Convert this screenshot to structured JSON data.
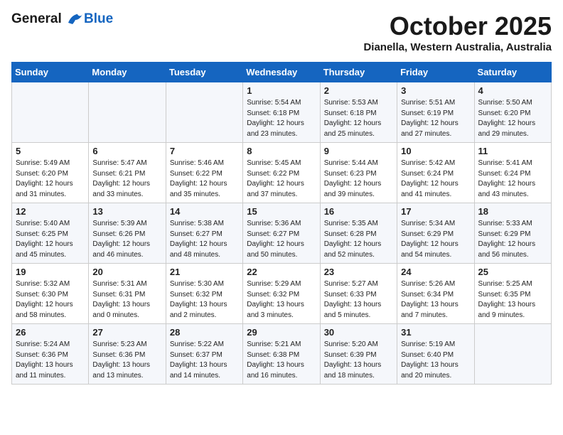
{
  "logo": {
    "line1": "General",
    "line2": "Blue"
  },
  "title": "October 2025",
  "location": "Dianella, Western Australia, Australia",
  "days_of_week": [
    "Sunday",
    "Monday",
    "Tuesday",
    "Wednesday",
    "Thursday",
    "Friday",
    "Saturday"
  ],
  "weeks": [
    [
      {
        "day": "",
        "info": ""
      },
      {
        "day": "",
        "info": ""
      },
      {
        "day": "",
        "info": ""
      },
      {
        "day": "1",
        "info": "Sunrise: 5:54 AM\nSunset: 6:18 PM\nDaylight: 12 hours\nand 23 minutes."
      },
      {
        "day": "2",
        "info": "Sunrise: 5:53 AM\nSunset: 6:18 PM\nDaylight: 12 hours\nand 25 minutes."
      },
      {
        "day": "3",
        "info": "Sunrise: 5:51 AM\nSunset: 6:19 PM\nDaylight: 12 hours\nand 27 minutes."
      },
      {
        "day": "4",
        "info": "Sunrise: 5:50 AM\nSunset: 6:20 PM\nDaylight: 12 hours\nand 29 minutes."
      }
    ],
    [
      {
        "day": "5",
        "info": "Sunrise: 5:49 AM\nSunset: 6:20 PM\nDaylight: 12 hours\nand 31 minutes."
      },
      {
        "day": "6",
        "info": "Sunrise: 5:47 AM\nSunset: 6:21 PM\nDaylight: 12 hours\nand 33 minutes."
      },
      {
        "day": "7",
        "info": "Sunrise: 5:46 AM\nSunset: 6:22 PM\nDaylight: 12 hours\nand 35 minutes."
      },
      {
        "day": "8",
        "info": "Sunrise: 5:45 AM\nSunset: 6:22 PM\nDaylight: 12 hours\nand 37 minutes."
      },
      {
        "day": "9",
        "info": "Sunrise: 5:44 AM\nSunset: 6:23 PM\nDaylight: 12 hours\nand 39 minutes."
      },
      {
        "day": "10",
        "info": "Sunrise: 5:42 AM\nSunset: 6:24 PM\nDaylight: 12 hours\nand 41 minutes."
      },
      {
        "day": "11",
        "info": "Sunrise: 5:41 AM\nSunset: 6:24 PM\nDaylight: 12 hours\nand 43 minutes."
      }
    ],
    [
      {
        "day": "12",
        "info": "Sunrise: 5:40 AM\nSunset: 6:25 PM\nDaylight: 12 hours\nand 45 minutes."
      },
      {
        "day": "13",
        "info": "Sunrise: 5:39 AM\nSunset: 6:26 PM\nDaylight: 12 hours\nand 46 minutes."
      },
      {
        "day": "14",
        "info": "Sunrise: 5:38 AM\nSunset: 6:27 PM\nDaylight: 12 hours\nand 48 minutes."
      },
      {
        "day": "15",
        "info": "Sunrise: 5:36 AM\nSunset: 6:27 PM\nDaylight: 12 hours\nand 50 minutes."
      },
      {
        "day": "16",
        "info": "Sunrise: 5:35 AM\nSunset: 6:28 PM\nDaylight: 12 hours\nand 52 minutes."
      },
      {
        "day": "17",
        "info": "Sunrise: 5:34 AM\nSunset: 6:29 PM\nDaylight: 12 hours\nand 54 minutes."
      },
      {
        "day": "18",
        "info": "Sunrise: 5:33 AM\nSunset: 6:29 PM\nDaylight: 12 hours\nand 56 minutes."
      }
    ],
    [
      {
        "day": "19",
        "info": "Sunrise: 5:32 AM\nSunset: 6:30 PM\nDaylight: 12 hours\nand 58 minutes."
      },
      {
        "day": "20",
        "info": "Sunrise: 5:31 AM\nSunset: 6:31 PM\nDaylight: 13 hours\nand 0 minutes."
      },
      {
        "day": "21",
        "info": "Sunrise: 5:30 AM\nSunset: 6:32 PM\nDaylight: 13 hours\nand 2 minutes."
      },
      {
        "day": "22",
        "info": "Sunrise: 5:29 AM\nSunset: 6:32 PM\nDaylight: 13 hours\nand 3 minutes."
      },
      {
        "day": "23",
        "info": "Sunrise: 5:27 AM\nSunset: 6:33 PM\nDaylight: 13 hours\nand 5 minutes."
      },
      {
        "day": "24",
        "info": "Sunrise: 5:26 AM\nSunset: 6:34 PM\nDaylight: 13 hours\nand 7 minutes."
      },
      {
        "day": "25",
        "info": "Sunrise: 5:25 AM\nSunset: 6:35 PM\nDaylight: 13 hours\nand 9 minutes."
      }
    ],
    [
      {
        "day": "26",
        "info": "Sunrise: 5:24 AM\nSunset: 6:36 PM\nDaylight: 13 hours\nand 11 minutes."
      },
      {
        "day": "27",
        "info": "Sunrise: 5:23 AM\nSunset: 6:36 PM\nDaylight: 13 hours\nand 13 minutes."
      },
      {
        "day": "28",
        "info": "Sunrise: 5:22 AM\nSunset: 6:37 PM\nDaylight: 13 hours\nand 14 minutes."
      },
      {
        "day": "29",
        "info": "Sunrise: 5:21 AM\nSunset: 6:38 PM\nDaylight: 13 hours\nand 16 minutes."
      },
      {
        "day": "30",
        "info": "Sunrise: 5:20 AM\nSunset: 6:39 PM\nDaylight: 13 hours\nand 18 minutes."
      },
      {
        "day": "31",
        "info": "Sunrise: 5:19 AM\nSunset: 6:40 PM\nDaylight: 13 hours\nand 20 minutes."
      },
      {
        "day": "",
        "info": ""
      }
    ]
  ]
}
